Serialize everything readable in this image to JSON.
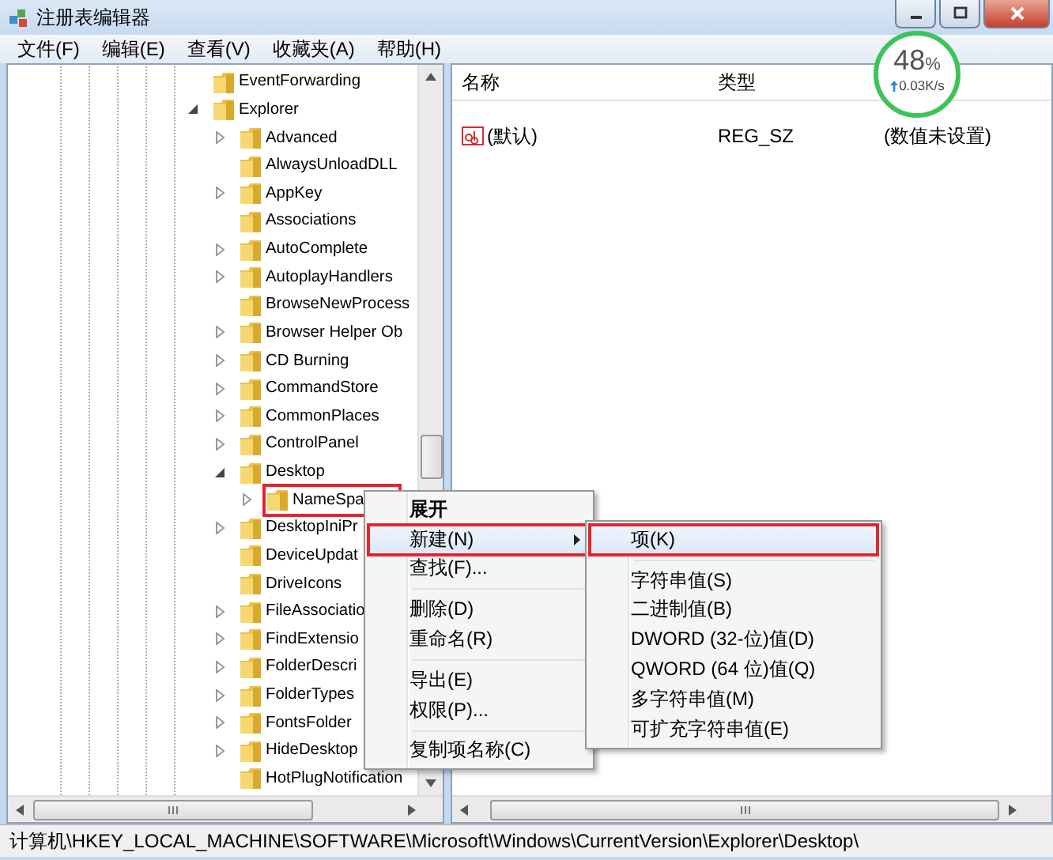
{
  "window": {
    "title": "注册表编辑器"
  },
  "menu_bar": [
    "文件(F)",
    "编辑(E)",
    "查看(V)",
    "收藏夹(A)",
    "帮助(H)"
  ],
  "tree": [
    {
      "label": "EventForwarding",
      "kind": "leaf"
    },
    {
      "label": "Explorer",
      "kind": "branch",
      "expanded": true,
      "children": [
        {
          "label": "Advanced",
          "kind": "branch",
          "expanded": false
        },
        {
          "label": "AlwaysUnloadDLL",
          "kind": "leaf"
        },
        {
          "label": "AppKey",
          "kind": "branch",
          "expanded": false
        },
        {
          "label": "Associations",
          "kind": "leaf"
        },
        {
          "label": "AutoComplete",
          "kind": "branch",
          "expanded": false
        },
        {
          "label": "AutoplayHandlers",
          "kind": "branch",
          "expanded": false
        },
        {
          "label": "BrowseNewProcess",
          "kind": "leaf"
        },
        {
          "label": "Browser Helper Ob",
          "kind": "branch",
          "expanded": false
        },
        {
          "label": "CD Burning",
          "kind": "branch",
          "expanded": false
        },
        {
          "label": "CommandStore",
          "kind": "branch",
          "expanded": false
        },
        {
          "label": "CommonPlaces",
          "kind": "branch",
          "expanded": false
        },
        {
          "label": "ControlPanel",
          "kind": "branch",
          "expanded": false
        },
        {
          "label": "Desktop",
          "kind": "branch",
          "expanded": true,
          "children": [
            {
              "label": "NameSpa",
              "kind": "branch",
              "expanded": false,
              "highlighted": true
            }
          ]
        },
        {
          "label": "DesktopIniPr",
          "kind": "branch",
          "expanded": false
        },
        {
          "label": "DeviceUpdat",
          "kind": "leaf"
        },
        {
          "label": "DriveIcons",
          "kind": "leaf"
        },
        {
          "label": "FileAssociatio",
          "kind": "branch",
          "expanded": false
        },
        {
          "label": "FindExtensio",
          "kind": "branch",
          "expanded": false
        },
        {
          "label": "FolderDescri",
          "kind": "branch",
          "expanded": false
        },
        {
          "label": "FolderTypes",
          "kind": "branch",
          "expanded": false
        },
        {
          "label": "FontsFolder",
          "kind": "branch",
          "expanded": false
        },
        {
          "label": "HideDesktop",
          "kind": "branch",
          "expanded": false
        },
        {
          "label": "HotPlugNotification",
          "kind": "leaf"
        }
      ]
    }
  ],
  "values_table": {
    "columns": [
      "名称",
      "类型"
    ],
    "rows": [
      {
        "name": "(默认)",
        "type": "REG_SZ",
        "data": "(数值未设置)"
      }
    ]
  },
  "status_bar": "计算机\\HKEY_LOCAL_MACHINE\\SOFTWARE\\Microsoft\\Windows\\CurrentVersion\\Explorer\\Desktop\\",
  "context_menu": [
    {
      "kind": "item",
      "label": "展开",
      "bold": true,
      "selected": false,
      "highlighted": false
    },
    {
      "kind": "item",
      "label": "新建(N)",
      "submenu": true,
      "selected": true,
      "highlighted": true
    },
    {
      "kind": "item",
      "label": "查找(F)...",
      "selected": false,
      "highlighted": false
    },
    {
      "kind": "separator"
    },
    {
      "kind": "item",
      "label": "删除(D)",
      "selected": false,
      "highlighted": false
    },
    {
      "kind": "item",
      "label": "重命名(R)",
      "selected": false,
      "highlighted": false
    },
    {
      "kind": "separator"
    },
    {
      "kind": "item",
      "label": "导出(E)",
      "selected": false,
      "highlighted": false
    },
    {
      "kind": "item",
      "label": "权限(P)...",
      "selected": false,
      "highlighted": false
    },
    {
      "kind": "separator"
    },
    {
      "kind": "item",
      "label": "复制项名称(C)",
      "selected": false,
      "highlighted": false
    }
  ],
  "submenu": [
    {
      "kind": "item",
      "label": "项(K)",
      "selected": true,
      "highlighted": true
    },
    {
      "kind": "separator"
    },
    {
      "kind": "item",
      "label": "字符串值(S)",
      "selected": false,
      "highlighted": false
    },
    {
      "kind": "item",
      "label": "二进制值(B)",
      "selected": false,
      "highlighted": false
    },
    {
      "kind": "item",
      "label": "DWORD (32-位)值(D)",
      "selected": false,
      "highlighted": false
    },
    {
      "kind": "item",
      "label": "QWORD (64 位)值(Q)",
      "selected": false,
      "highlighted": false
    },
    {
      "kind": "item",
      "label": "多字符串值(M)",
      "selected": false,
      "highlighted": false
    },
    {
      "kind": "item",
      "label": "可扩充字符串值(E)",
      "selected": false,
      "highlighted": false
    }
  ],
  "speed_widget": {
    "percent": "48",
    "unit": "%",
    "rate": "0.03K/s"
  }
}
